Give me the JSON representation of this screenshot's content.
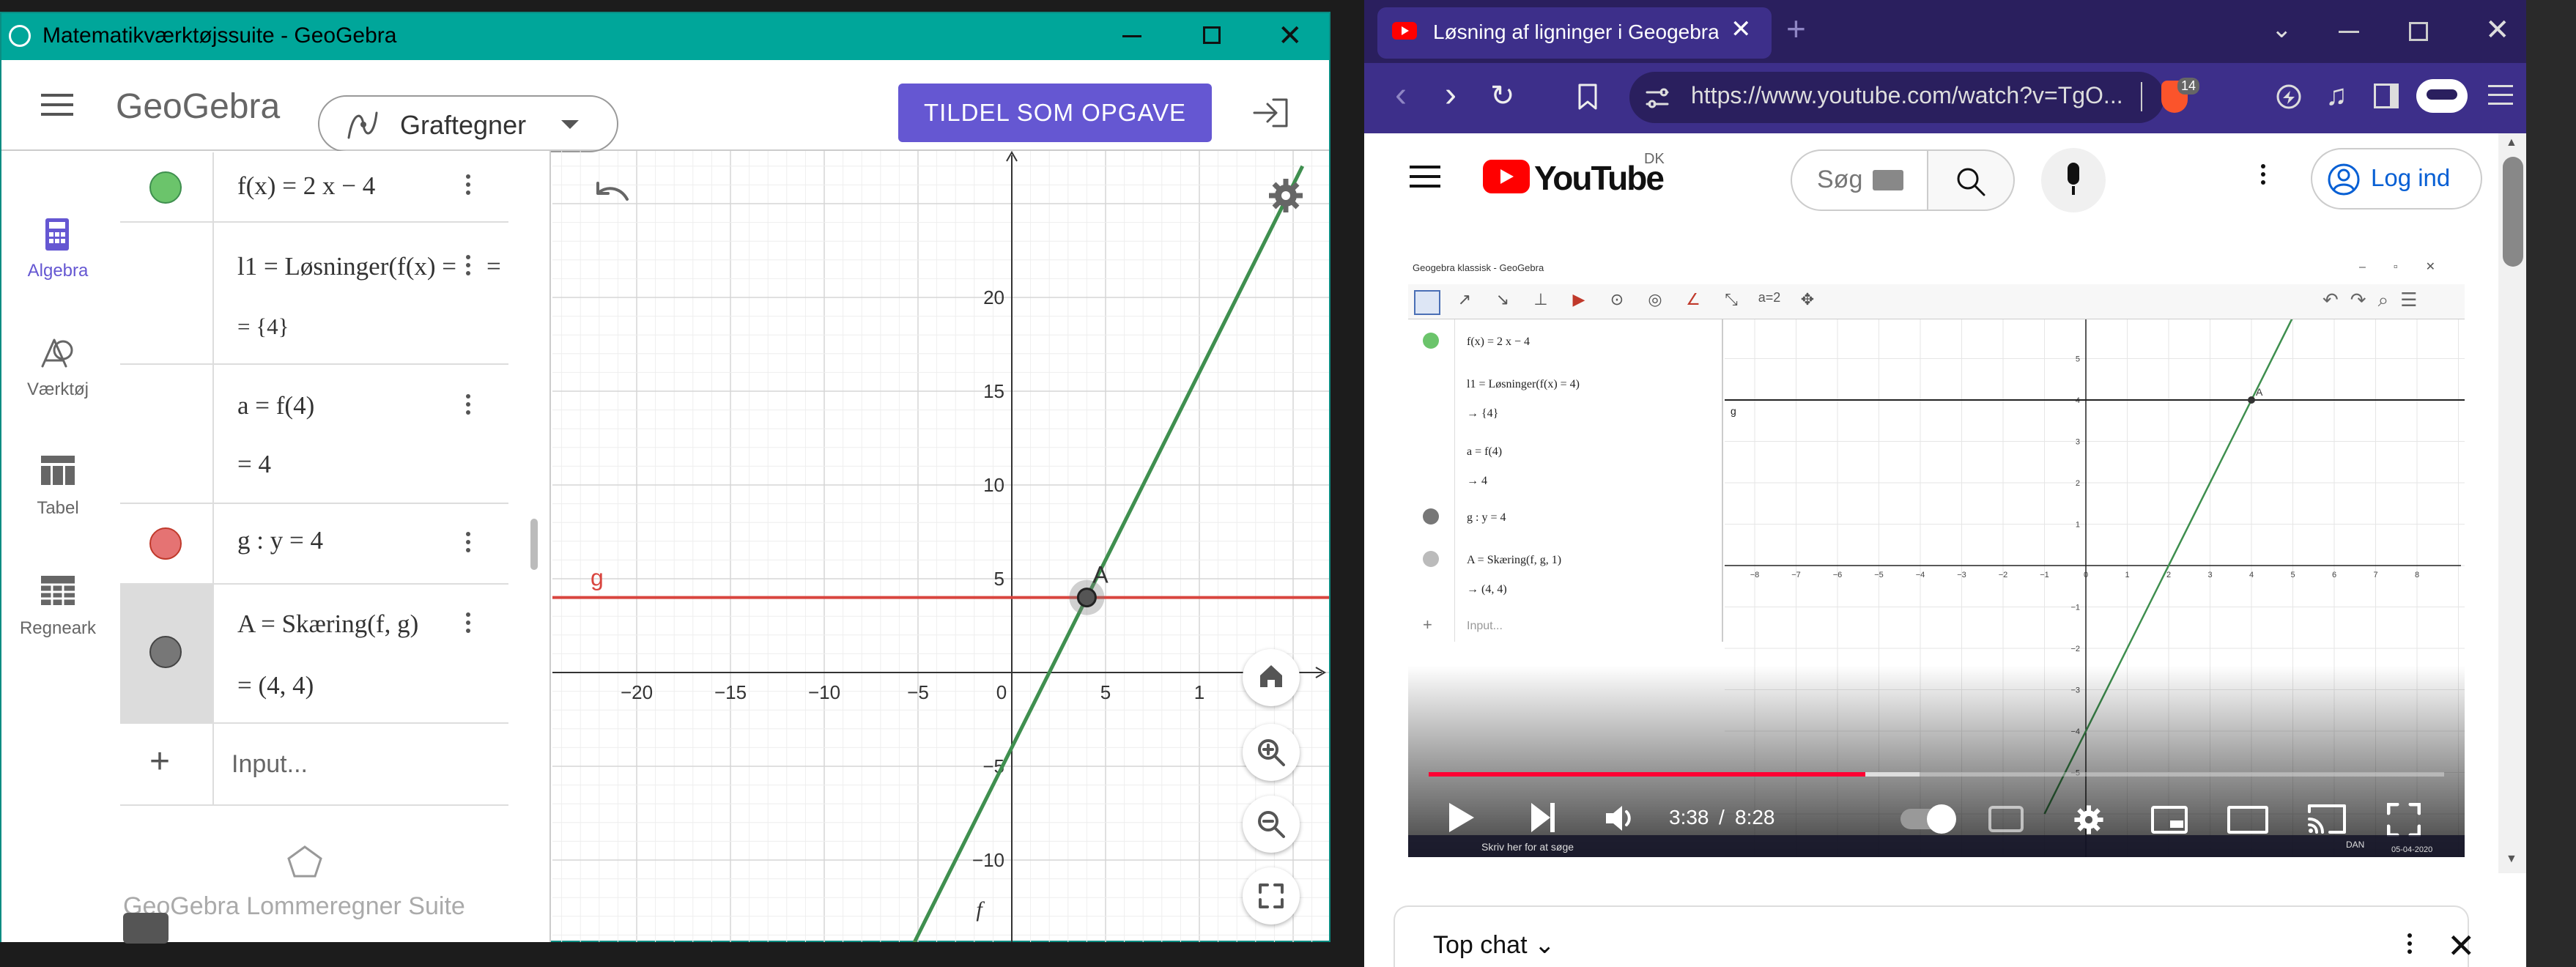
{
  "desktop": {
    "background_color": "#1c1c1c"
  },
  "geogebra": {
    "window_title": "Matematikværktøjssuite - GeoGebra",
    "title_bar_color": "#00a69a",
    "logo_text": "GeoGebra",
    "app_switch_label": "Graftegner",
    "assign_button_label": "TILDEL SOM OPGAVE",
    "accent_color": "#6557d2",
    "nav": [
      {
        "label": "Algebra",
        "icon": "calculator-icon"
      },
      {
        "label": "Værktøj",
        "icon": "tools-icon"
      },
      {
        "label": "Tabel",
        "icon": "table-icon"
      },
      {
        "label": "Regneark",
        "icon": "spreadsheet-icon"
      }
    ],
    "algebra": [
      {
        "line1": "f(x)  =  2 x − 4",
        "line2": "",
        "dot_color": "#6bc46b"
      },
      {
        "line1": "l1  =  Løsninger(f(x)  =",
        "line2": "=  {4}",
        "dot_color": ""
      },
      {
        "line1": "a  =  f(4)",
        "line2": "=  4",
        "dot_color": ""
      },
      {
        "line1": "g : y  =  4",
        "line2": "",
        "dot_color": "#e57373"
      },
      {
        "line1": "A  =  Skæring(f, g)",
        "line2": "=  (4, 4)",
        "dot_color": "#777777"
      }
    ],
    "input_placeholder": "Input...",
    "footer_text": "GeoGebra Lommeregner Suite",
    "graph": {
      "x_ticks": [
        "−20",
        "−15",
        "−10",
        "−5",
        "0",
        "5",
        "1"
      ],
      "y_ticks": [
        "20",
        "15",
        "10",
        "5",
        "−5",
        "−10"
      ],
      "line_g_label": "g",
      "line_f_label": "f",
      "point_label": "A",
      "line_f_color": "#3f8f4f",
      "line_g_color": "#d9453f"
    }
  },
  "browser": {
    "tab_title": "Løsning af ligninger i Geogebra",
    "url": "https://www.youtube.com/watch?v=TgO...",
    "shield_badge": "14",
    "youtube": {
      "logo_text": "YouTube",
      "region": "DK",
      "search_placeholder": "Søg",
      "login_label": "Log ind",
      "time_current": "3:38",
      "time_separator": "/",
      "time_total": "8:28",
      "progress_fraction": 0.43,
      "top_chat_label": "Top chat",
      "brand_color": "#ff0000"
    },
    "video": {
      "window_title": "Geogebra klassisk - GeoGebra",
      "algebra": [
        {
          "line1": "f(x)  =  2 x − 4",
          "line2": ""
        },
        {
          "line1": "l1 = Løsninger(f(x) = 4)",
          "line2": "→  {4}"
        },
        {
          "line1": "a = f(4)",
          "line2": "→  4"
        },
        {
          "line1": "g : y = 4",
          "line2": ""
        },
        {
          "line1": "A = Skæring(f, g, 1)",
          "line2": "→  (4, 4)"
        }
      ],
      "input_placeholder": "Input...",
      "taskbar_search": "Skriv her for at søge",
      "graph_label_g": "g",
      "graph_label_a": "A",
      "x_ticks": [
        "−8",
        "−7",
        "−6",
        "−5",
        "−4",
        "−3",
        "−2",
        "−1",
        "0",
        "1",
        "2",
        "3",
        "4",
        "5",
        "6",
        "7",
        "8"
      ],
      "y_ticks": [
        "5",
        "4",
        "3",
        "2",
        "1",
        "−1",
        "−2",
        "−3",
        "−4",
        "−5"
      ],
      "taskbar_lang": "DAN",
      "taskbar_date": "05-04-2020"
    }
  }
}
